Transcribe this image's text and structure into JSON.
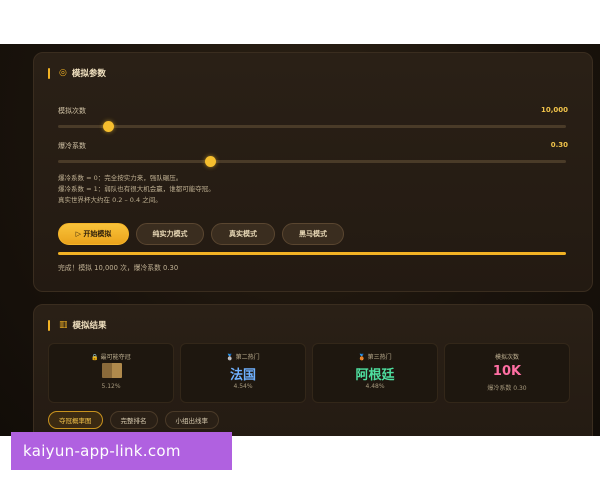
{
  "params": {
    "title": "模拟参数",
    "icon": "target-icon",
    "simulations": {
      "label": "模拟次数",
      "value": "10,000",
      "fraction": 0.1
    },
    "upset": {
      "label": "爆冷系数",
      "value": "0.30",
      "fraction": 0.3
    },
    "description": [
      "爆冷系数 = 0：完全按实力来，强队碾压。",
      "爆冷系数 = 1：弱队也有很大机会赢，谁都可能夺冠。",
      "真实世界杯大约在 0.2 – 0.4 之间。"
    ],
    "buttons": {
      "start": "▷ 开始模拟",
      "strength": "纯实力模式",
      "realistic": "真实模式",
      "darkhorse": "黑马模式"
    },
    "progress": 1.0,
    "done_text": "完成！模拟 10,000 次，爆冷系数 0.30"
  },
  "results": {
    "title": "模拟结果",
    "icon": "bar-chart-icon",
    "cards": [
      {
        "label": "🔒 最可能夺冠",
        "value": "",
        "sub": "5.12%"
      },
      {
        "label": "🥈 第二热门",
        "value": "法国",
        "sub": "4.54%"
      },
      {
        "label": "🥉 第三热门",
        "value": "阿根廷",
        "sub": "4.48%"
      },
      {
        "label": "模拟次数",
        "value": "10K",
        "sub": "爆冷系数 0.30"
      }
    ],
    "tabs": [
      "夺冠概率图",
      "完整排名",
      "小组出线率"
    ]
  },
  "watermark": "kaiyun-app-link.com",
  "colors": {
    "accent": "#f2b224",
    "blue": "#6fb1ff",
    "green": "#4fe0a0",
    "pink": "#ff6fa3"
  }
}
